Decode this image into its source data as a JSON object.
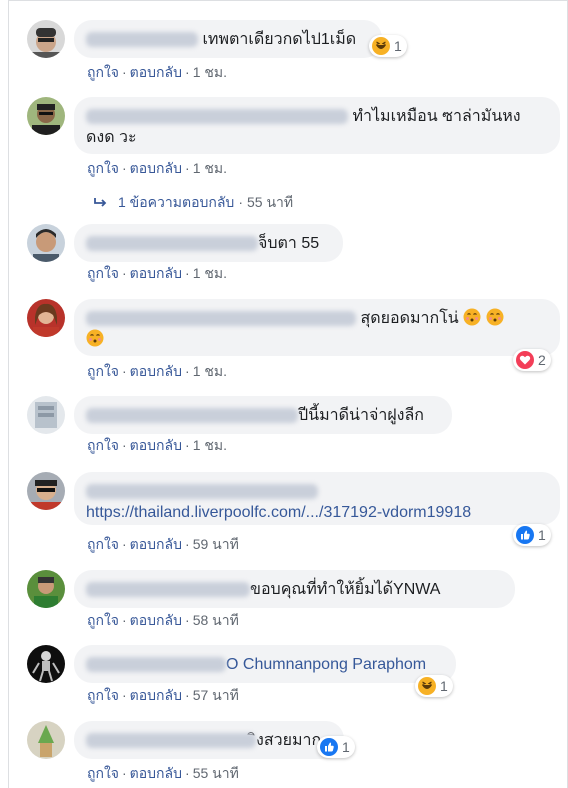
{
  "actions": {
    "like": "ถูกใจ",
    "reply": "ตอบกลับ",
    "sep": "·"
  },
  "comments": [
    {
      "text": "เทพตาเดียวกดไป1เม็ด",
      "time": "1 ชม.",
      "reaction": {
        "icon": "haha-emoji",
        "count": "1"
      }
    },
    {
      "text": "ทำไมเหมือน ซาล่ามันหงดงด วะ",
      "text_line1": "ทำไมเหมือน ซาล่ามันหง",
      "text_line2": "ดงด วะ",
      "time": "1 ชม."
    },
    {
      "text": "จ็บตา 55",
      "time": "1 ชม."
    },
    {
      "text": "สุดยอดมากโน่",
      "time": "1 ชม.",
      "reaction": {
        "icon": "love-heart",
        "count": "2"
      }
    },
    {
      "text": "ปีนี้มาดีน่าจ่าฝูงลีก",
      "time": "1 ชม."
    },
    {
      "link": "https://thailand.liverpoolfc.com/.../317192-vdorm19918",
      "time": "59 นาที",
      "reaction": {
        "icon": "like-thumb",
        "count": "1"
      }
    },
    {
      "text": "ขอบคุณที่ทำให้ยิ้มได้YNWA",
      "time": "58 นาที"
    },
    {
      "tag": "O Chumnanpong Paraphom",
      "time": "57 นาที",
      "reaction": {
        "icon": "haha-emoji",
        "count": "1"
      }
    },
    {
      "text": "ิงสวยมาก",
      "time": "55 นาที",
      "reaction": {
        "icon": "like-thumb",
        "count": "1"
      }
    }
  ],
  "replies_link": {
    "label": "1 ข้อความตอบกลับ",
    "time": "55 นาที"
  },
  "colors": {
    "link": "#385898",
    "bubble": "#f2f3f5",
    "like_blue": "#1877f2",
    "love_red": "#f33e58",
    "haha_yellow": "#f7b125"
  }
}
